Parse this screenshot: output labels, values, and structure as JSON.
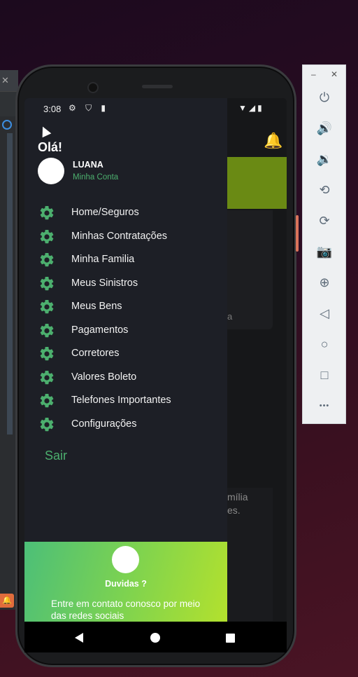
{
  "status_bar": {
    "time": "3:08",
    "left_icons": "⚙ ⛉ ▮",
    "right_icons": "▼◢▮"
  },
  "drawer": {
    "greeting": "Olá!",
    "user": {
      "name": "LUANA",
      "account_link": "Minha Conta"
    },
    "menu_items": [
      {
        "label": "Home/Seguros",
        "icon": "gear-icon"
      },
      {
        "label": "Minhas Contratações",
        "icon": "gear-icon"
      },
      {
        "label": "Minha Familia",
        "icon": "gear-icon"
      },
      {
        "label": "Meus Sinistros",
        "icon": "gear-icon"
      },
      {
        "label": "Meus Bens",
        "icon": "gear-icon"
      },
      {
        "label": "Pagamentos",
        "icon": "gear-icon"
      },
      {
        "label": "Corretores",
        "icon": "gear-icon"
      },
      {
        "label": "Valores Boleto",
        "icon": "gear-icon"
      },
      {
        "label": "Telefones Importantes",
        "icon": "gear-icon"
      },
      {
        "label": "Configurações",
        "icon": "gear-icon"
      }
    ],
    "logout_label": "Sair",
    "help": {
      "title": "Duvidas ?",
      "text": "Entre em contato conosco por meio das redes sociais"
    }
  },
  "background_app": {
    "partial_text_1": "a",
    "partial_text_2": "mília\nes."
  },
  "emulator_toolbar": {
    "window_min": "–",
    "window_close": "✕",
    "buttons": [
      {
        "name": "power-button",
        "glyph": "⏻"
      },
      {
        "name": "volume-up-button",
        "glyph": "🔊"
      },
      {
        "name": "volume-down-button",
        "glyph": "🔉"
      },
      {
        "name": "rotate-left-button",
        "glyph": "⟲"
      },
      {
        "name": "rotate-right-button",
        "glyph": "⟳"
      },
      {
        "name": "screenshot-button",
        "glyph": "📷"
      },
      {
        "name": "zoom-button",
        "glyph": "⊕"
      },
      {
        "name": "back-button",
        "glyph": "◁"
      },
      {
        "name": "home-button",
        "glyph": "○"
      },
      {
        "name": "overview-button",
        "glyph": "□"
      },
      {
        "name": "more-button",
        "glyph": "•••"
      }
    ]
  },
  "colors": {
    "accent_green": "#4caf6e",
    "drawer_bg": "#1d1f26",
    "help_gradient_start": "#4cbf78",
    "help_gradient_end": "#b7e22b"
  }
}
